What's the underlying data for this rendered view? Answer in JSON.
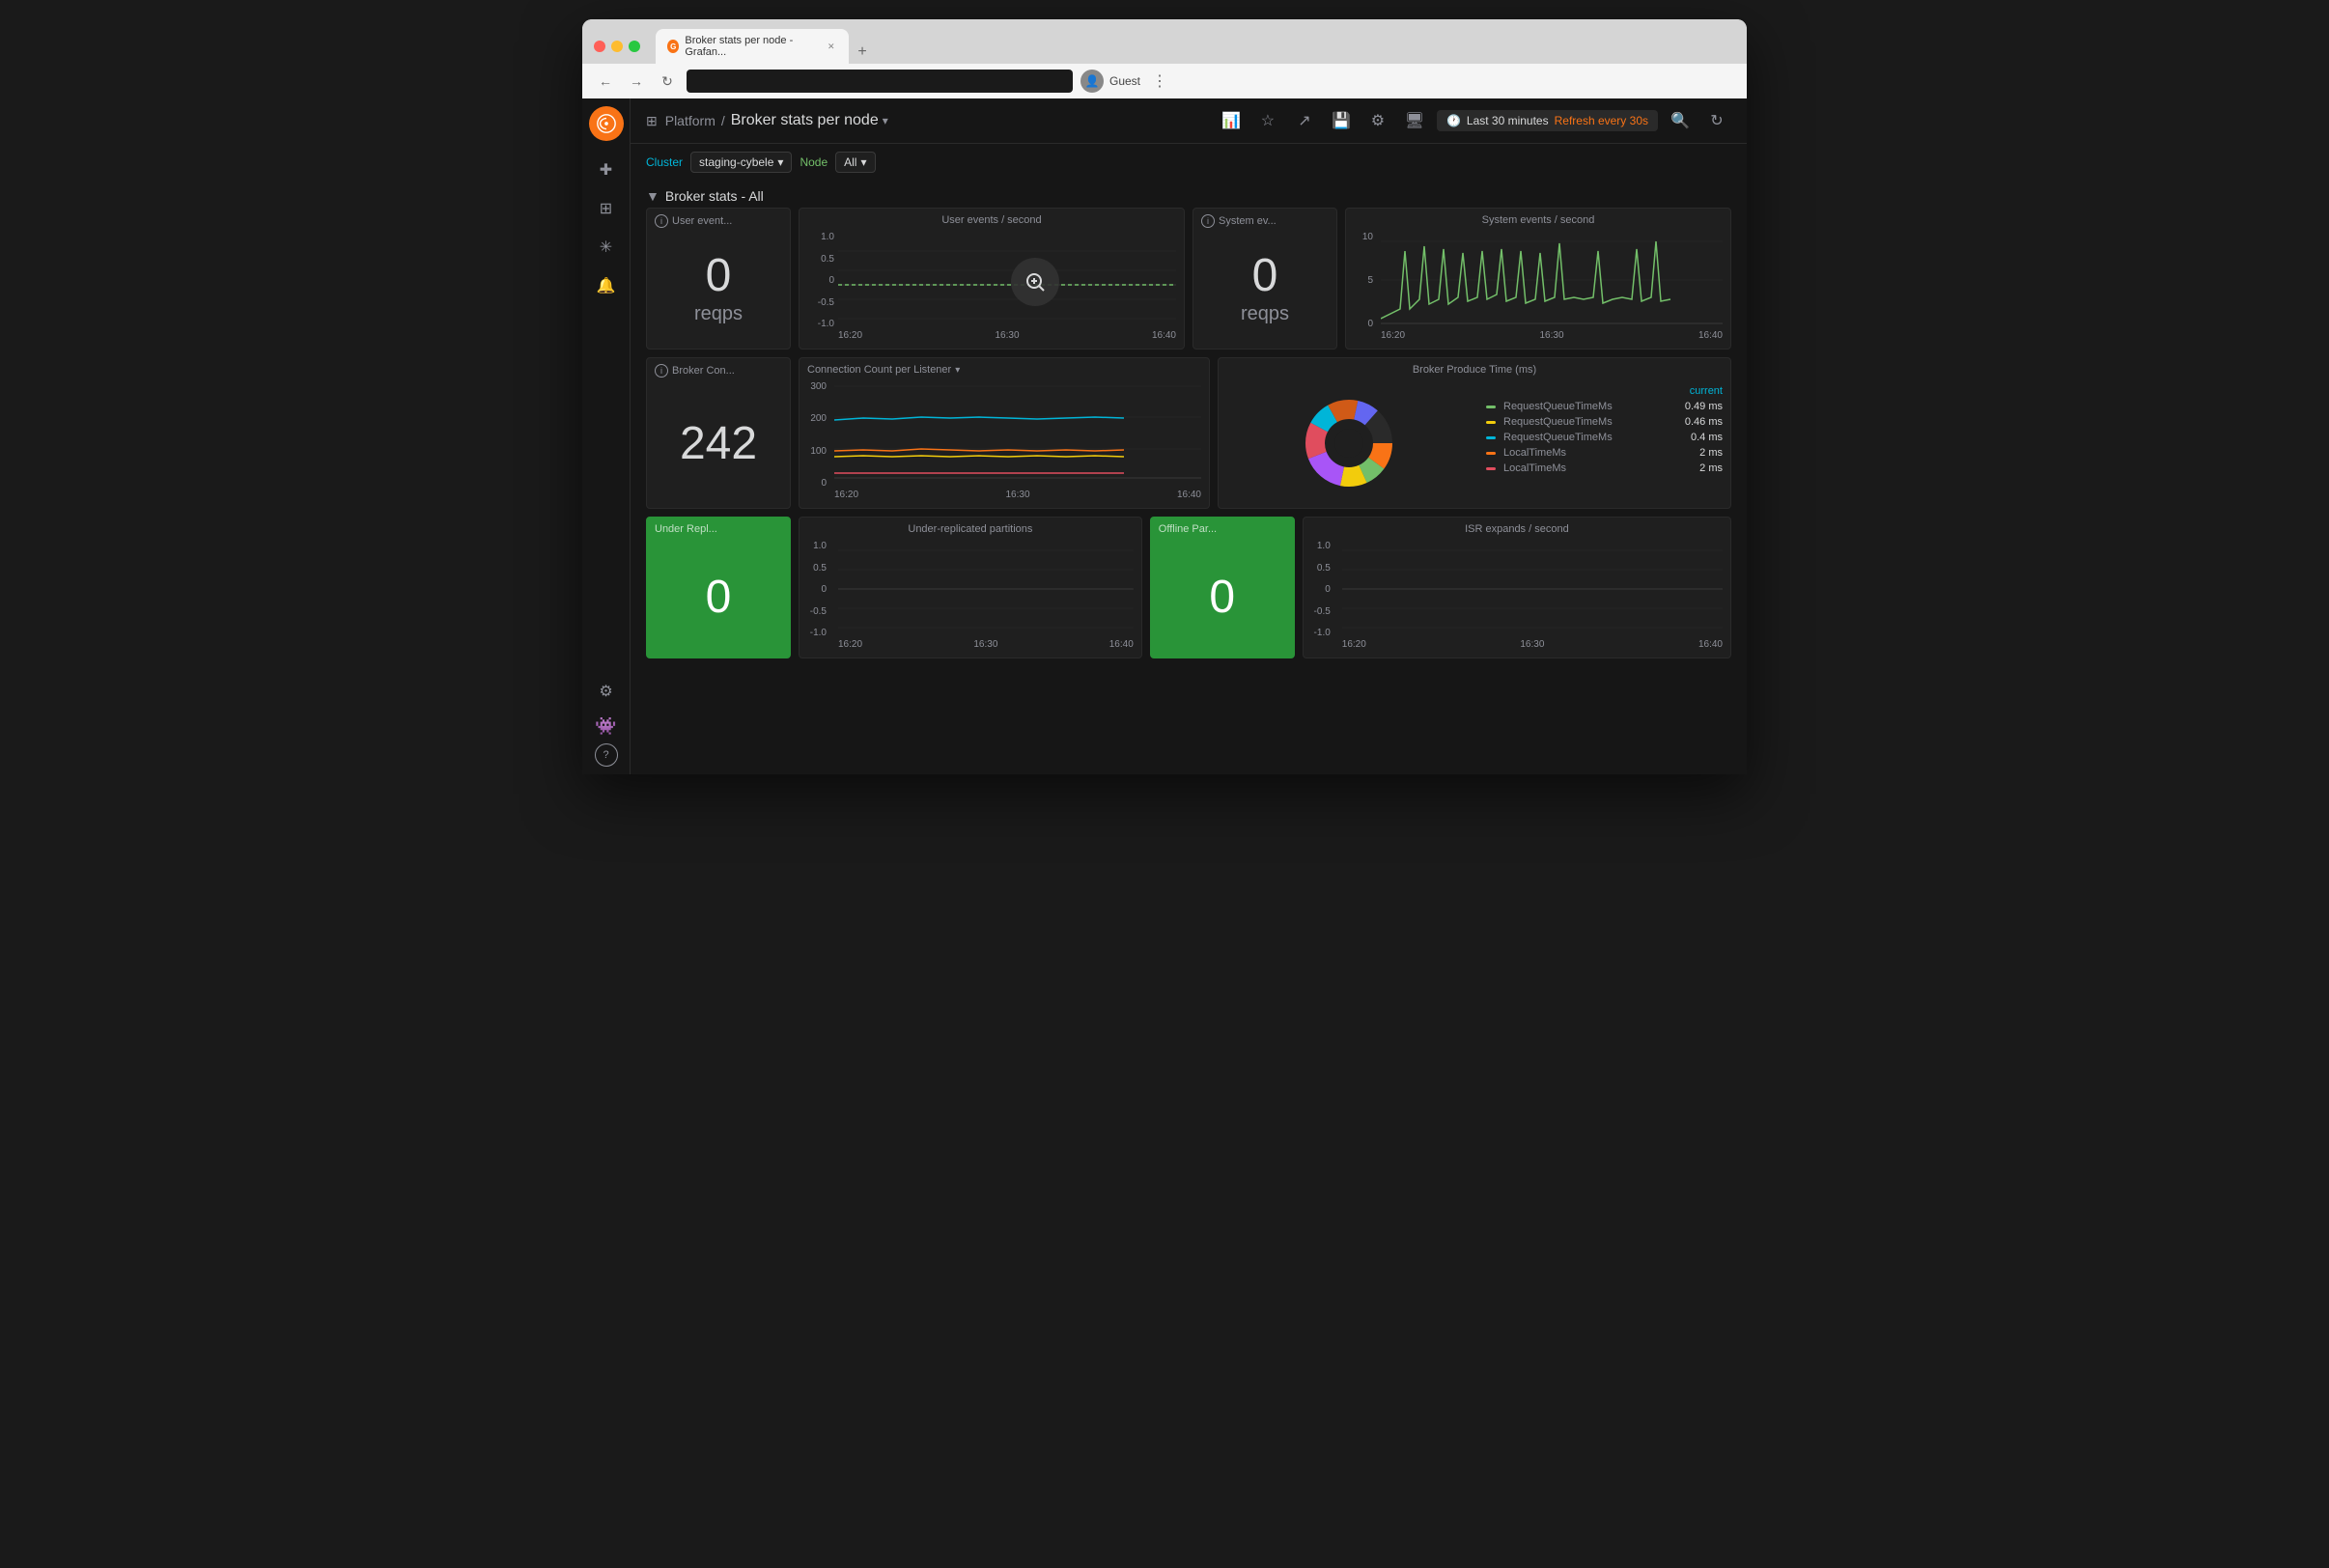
{
  "browser": {
    "tab_title": "Broker stats per node - Grafan...",
    "tab_favicon": "G",
    "address_bar": "",
    "user_label": "Guest",
    "new_tab_label": "+"
  },
  "topbar": {
    "grid_icon": "⊞",
    "breadcrumb_parent": "Platform",
    "separator": "/",
    "dashboard_title": "Broker stats per node",
    "dropdown_arrow": "▾",
    "time_range": "Last 30 minutes",
    "refresh_label": "Refresh every 30s",
    "actions": {
      "add": "+",
      "star": "☆",
      "share": "⊡",
      "save": "□",
      "settings": "⚙",
      "display": "▭",
      "search": "🔍",
      "refresh_icon": "↻"
    }
  },
  "filters": {
    "cluster_label": "Cluster",
    "cluster_value": "staging-cybele",
    "node_label": "Node",
    "node_value": "All"
  },
  "section": {
    "title": "Broker stats - All",
    "collapse_icon": "▼"
  },
  "sidebar": {
    "logo": "◎",
    "items": [
      {
        "name": "add",
        "icon": "+"
      },
      {
        "name": "dashboard",
        "icon": "⊞"
      },
      {
        "name": "explore",
        "icon": "✳"
      },
      {
        "name": "alerting",
        "icon": "🔔"
      },
      {
        "name": "settings",
        "icon": "⚙"
      }
    ],
    "avatar": "👾",
    "help": "?"
  },
  "panels": {
    "user_events_stat": {
      "title": "User event...",
      "value": "0",
      "unit": "reqps"
    },
    "user_events_chart": {
      "title": "User events / second",
      "y_axis": [
        "1.0",
        "0.5",
        "0",
        "-0.5",
        "-1.0"
      ],
      "x_axis": [
        "16:20",
        "16:30",
        "16:40"
      ]
    },
    "system_events_stat": {
      "title": "System ev...",
      "value": "0",
      "unit": "reqps"
    },
    "system_events_chart": {
      "title": "System events / second",
      "y_axis": [
        "10",
        "5",
        "0"
      ],
      "x_axis": [
        "16:20",
        "16:30",
        "16:40"
      ]
    },
    "broker_conn": {
      "title": "Broker Con...",
      "value": "242"
    },
    "conn_count_chart": {
      "title": "Connection Count per Listener",
      "y_axis": [
        "300",
        "200",
        "100",
        "0"
      ],
      "x_axis": [
        "16:20",
        "16:30",
        "16:40"
      ],
      "has_dropdown": true
    },
    "broker_produce": {
      "title": "Broker Produce Time (ms)",
      "current_label": "current",
      "legend": [
        {
          "label": "RequestQueueTimeMs",
          "value": "0.49 ms",
          "color": "#73bf69"
        },
        {
          "label": "RequestQueueTimeMs",
          "value": "0.46 ms",
          "color": "#f2cc0c"
        },
        {
          "label": "RequestQueueTimeMs",
          "value": "0.4 ms",
          "color": "#00b5d8"
        },
        {
          "label": "LocalTimeMs",
          "value": "2 ms",
          "color": "#f97316"
        },
        {
          "label": "LocalTimeMs",
          "value": "2 ms",
          "color": "#e04d5e"
        }
      ]
    },
    "under_repl": {
      "title": "Under Repl...",
      "value": "0"
    },
    "under_repl_chart": {
      "title": "Under-replicated partitions",
      "y_axis": [
        "1.0",
        "0.5",
        "0",
        "-0.5",
        "-1.0"
      ],
      "x_axis": [
        "16:20",
        "16:30",
        "16:40"
      ]
    },
    "offline_par": {
      "title": "Offline Par...",
      "value": "0"
    },
    "isr_chart": {
      "title": "ISR expands / second",
      "y_axis": [
        "1.0",
        "0.5",
        "0",
        "-0.5",
        "-1.0"
      ],
      "x_axis": [
        "16:20",
        "16:30",
        "16:40"
      ]
    }
  }
}
